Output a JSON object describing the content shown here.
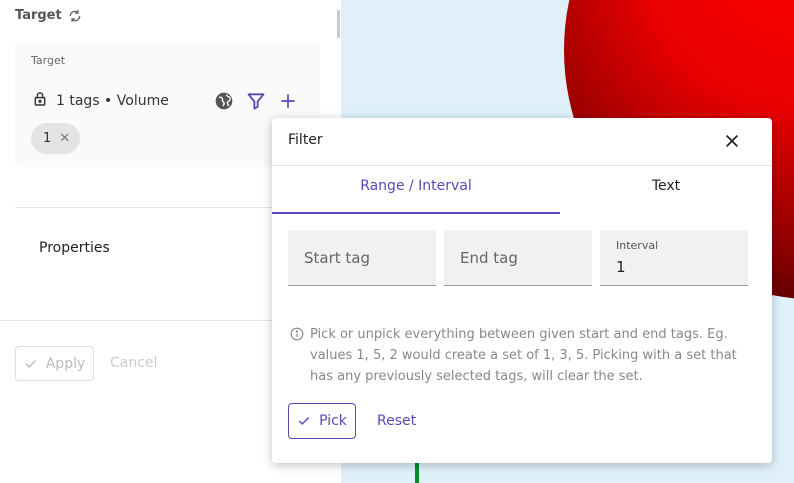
{
  "panel": {
    "title": "Target"
  },
  "target": {
    "label": "Target",
    "summary": "1 tags • Volume",
    "chip": "1",
    "icons": [
      "lock-icon",
      "globe-icon",
      "filter-icon",
      "plus-icon"
    ]
  },
  "properties": {
    "label": "Properties"
  },
  "actions": {
    "apply": "Apply",
    "cancel": "Cancel"
  },
  "dialog": {
    "title": "Filter",
    "tabs": [
      {
        "label": "Range / Interval",
        "active": true
      },
      {
        "label": "Text",
        "active": false
      }
    ],
    "start_tag": {
      "placeholder": "Start tag",
      "value": ""
    },
    "end_tag": {
      "placeholder": "End tag",
      "value": ""
    },
    "interval": {
      "label": "Interval",
      "value": "1"
    },
    "info": "Pick or unpick everything between given start and end tags. Eg. values 1, 5, 2 would create a set of 1, 3, 5. Picking with a set that has any previously selected tags, will clear the set.",
    "pick": "Pick",
    "reset": "Reset"
  },
  "colors": {
    "accent": "#5a48b8",
    "viewport_bg": "#dff0fb",
    "sphere": "#ff0000"
  }
}
